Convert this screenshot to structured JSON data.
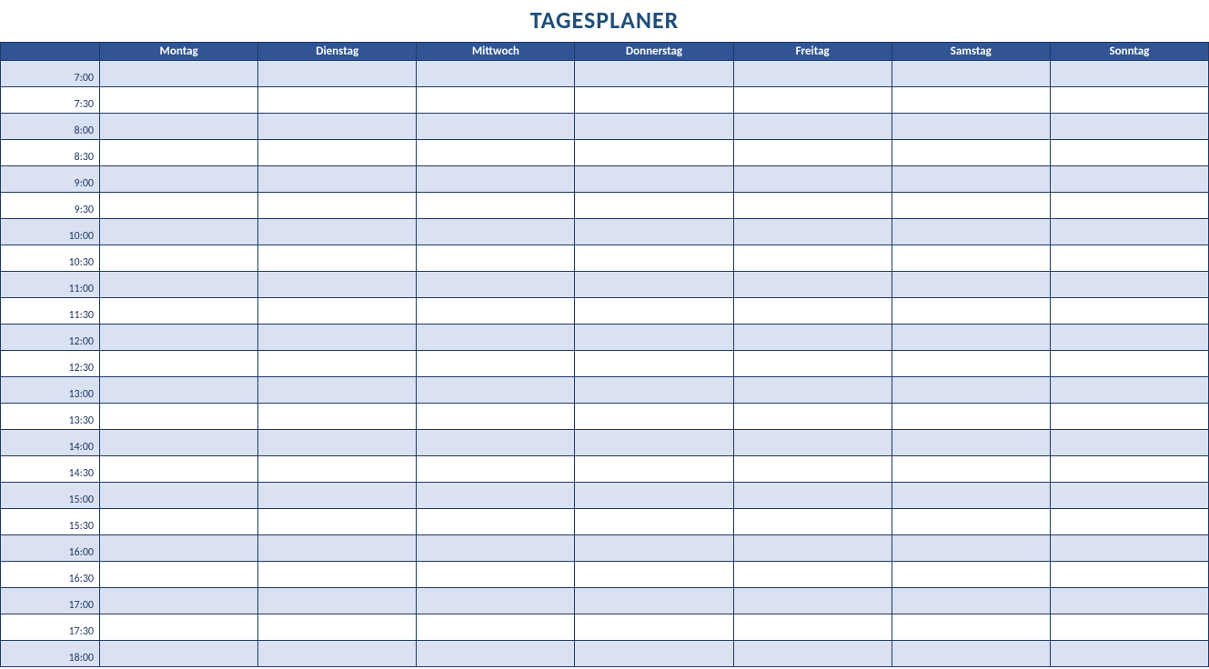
{
  "title": "TAGESPLANER",
  "header": {
    "timeColumn": "",
    "days": [
      "Montag",
      "Dienstag",
      "Mittwoch",
      "Donnerstag",
      "Freitag",
      "Samstag",
      "Sonntag"
    ]
  },
  "timeSlots": [
    "7:00",
    "7:30",
    "8:00",
    "8:30",
    "9:00",
    "9:30",
    "10:00",
    "10:30",
    "11:00",
    "11:30",
    "12:00",
    "12:30",
    "13:00",
    "13:30",
    "14:00",
    "14:30",
    "15:00",
    "15:30",
    "16:00",
    "16:30",
    "17:00",
    "17:30",
    "18:00"
  ],
  "colors": {
    "headerBg": "#305496",
    "headerText": "#ffffff",
    "titleText": "#1F4E79",
    "rowAlt": "#D9E1F2",
    "rowBase": "#ffffff",
    "border": "#203864"
  }
}
